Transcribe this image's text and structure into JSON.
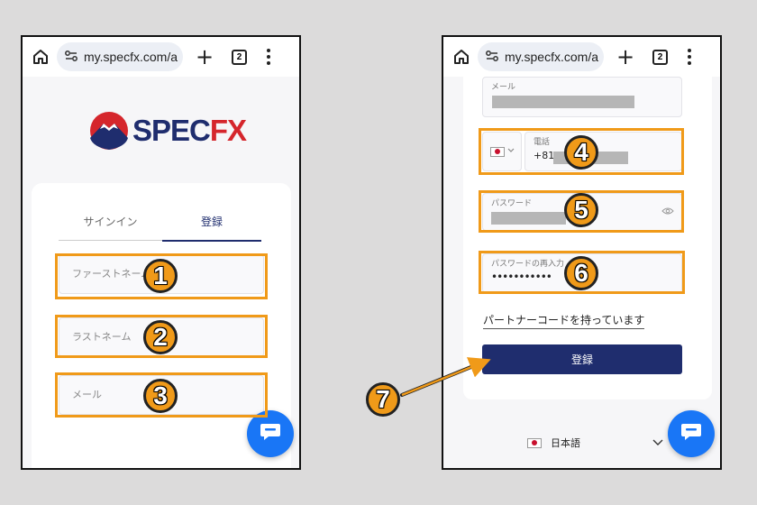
{
  "browser": {
    "url": "my.specfx.com/a",
    "tab_count": "2"
  },
  "logo": {
    "text_primary": "SPEC",
    "text_accent": "FX",
    "colors": {
      "primary": "#1f2d6e",
      "accent": "#d5262c"
    }
  },
  "auth_tabs": {
    "signin": "サインイン",
    "register": "登録"
  },
  "left_form": {
    "first_name_placeholder": "ファーストネーム",
    "last_name_placeholder": "ラストネーム",
    "email_placeholder": "メール"
  },
  "right_form": {
    "email_label": "メール",
    "phone_label": "電話",
    "phone_code": "+81",
    "password_label": "パスワード",
    "password_confirm_label": "パスワードの再入力",
    "password_confirm_value": "•••••••••••",
    "partner_code_link": "パートナーコードを持っています",
    "submit_label": "登録",
    "language": "日本語"
  },
  "annotations": {
    "step1": "1",
    "step2": "2",
    "step3": "3",
    "step4": "4",
    "step5": "5",
    "step6": "6",
    "step7": "7",
    "highlight_color": "#f09a19"
  },
  "icons": [
    "home-icon",
    "site-settings-icon",
    "new-tab-plus-icon",
    "tab-count-icon",
    "more-menu-icon",
    "chat-icon",
    "phone-globe-icon",
    "eye-icon",
    "chevron-down-icon",
    "japan-flag-icon"
  ]
}
